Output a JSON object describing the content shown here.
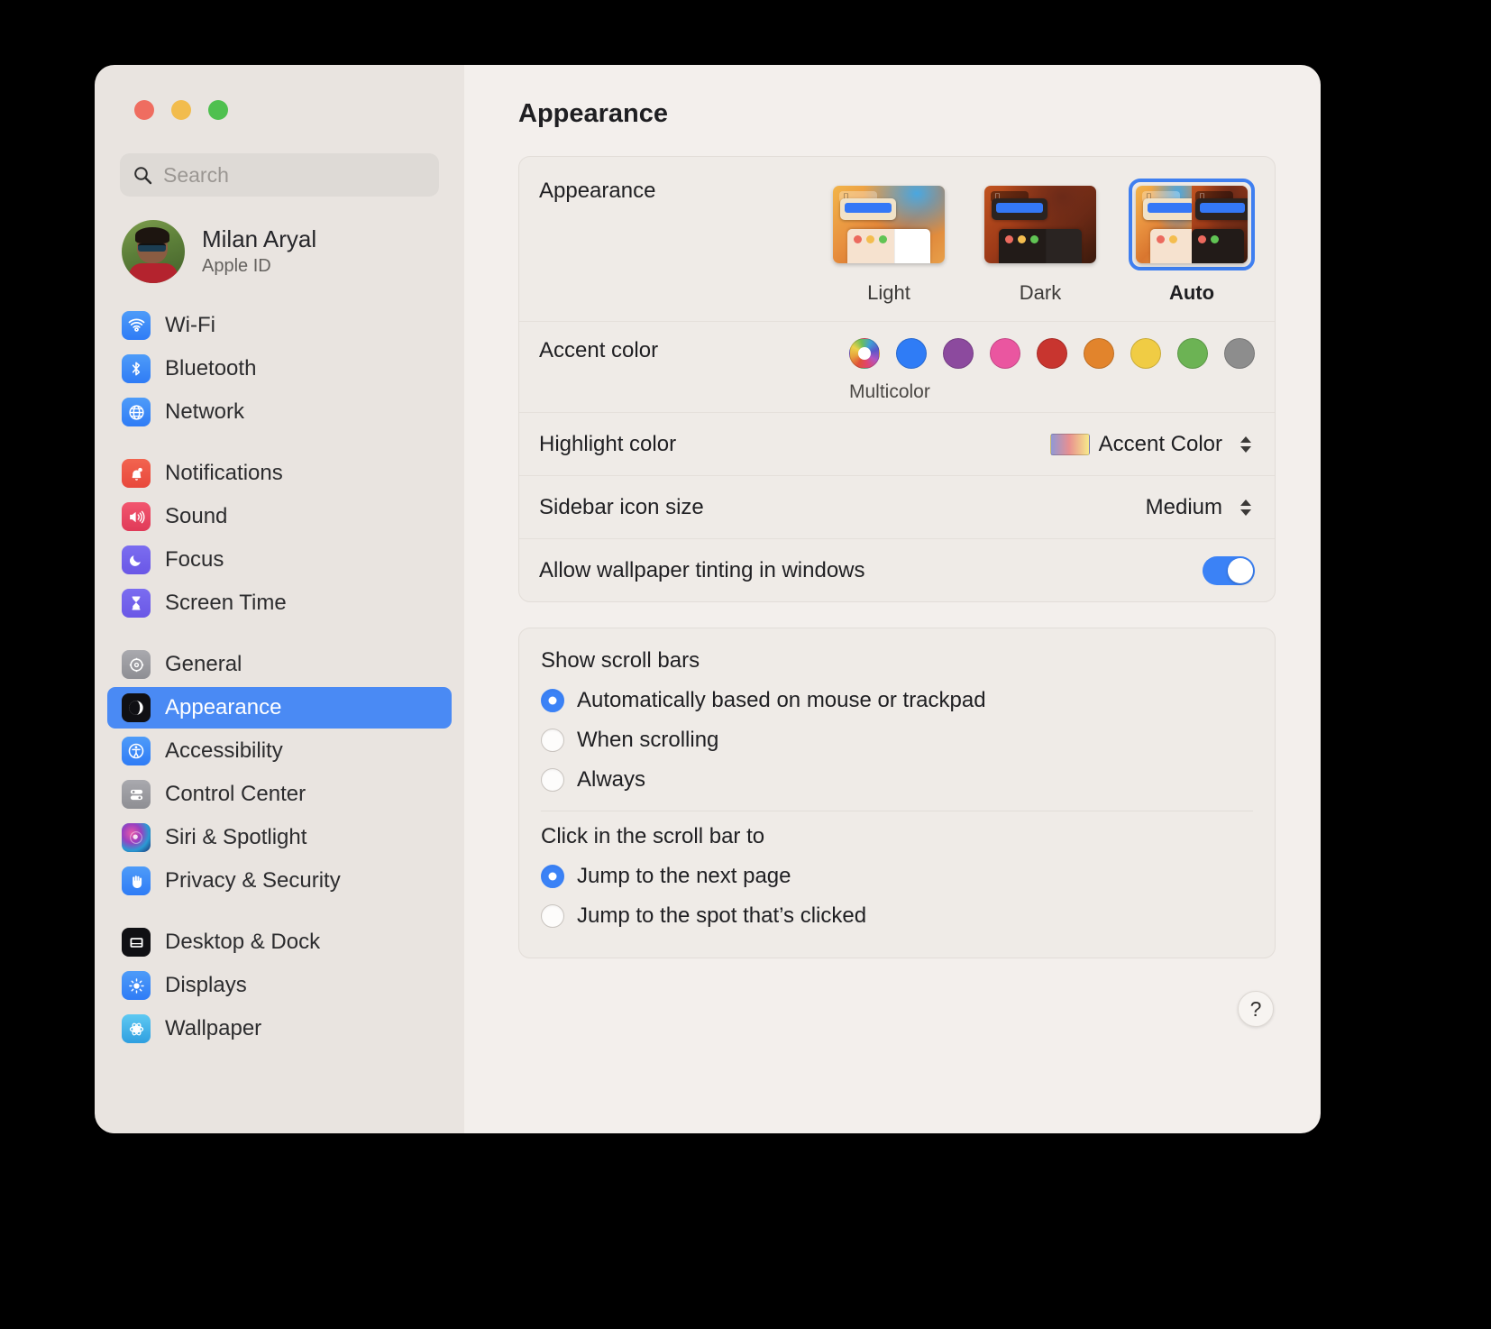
{
  "window": {
    "controls": [
      "close",
      "minimize",
      "zoom"
    ]
  },
  "sidebar": {
    "search": {
      "placeholder": "Search",
      "value": ""
    },
    "profile": {
      "name": "Milan Aryal",
      "subtitle": "Apple ID"
    },
    "groups": [
      {
        "items": [
          {
            "label": "Wi-Fi",
            "icon": "wifi-icon"
          },
          {
            "label": "Bluetooth",
            "icon": "bluetooth-icon"
          },
          {
            "label": "Network",
            "icon": "network-icon"
          }
        ]
      },
      {
        "items": [
          {
            "label": "Notifications",
            "icon": "notifications-icon"
          },
          {
            "label": "Sound",
            "icon": "sound-icon"
          },
          {
            "label": "Focus",
            "icon": "focus-icon"
          },
          {
            "label": "Screen Time",
            "icon": "screen-time-icon"
          }
        ]
      },
      {
        "items": [
          {
            "label": "General",
            "icon": "general-icon"
          },
          {
            "label": "Appearance",
            "icon": "appearance-icon",
            "selected": true
          },
          {
            "label": "Accessibility",
            "icon": "accessibility-icon"
          },
          {
            "label": "Control Center",
            "icon": "control-center-icon"
          },
          {
            "label": "Siri & Spotlight",
            "icon": "siri-icon"
          },
          {
            "label": "Privacy & Security",
            "icon": "privacy-icon"
          }
        ]
      },
      {
        "items": [
          {
            "label": "Desktop & Dock",
            "icon": "desktop-dock-icon"
          },
          {
            "label": "Displays",
            "icon": "displays-icon"
          },
          {
            "label": "Wallpaper",
            "icon": "wallpaper-icon"
          }
        ]
      }
    ]
  },
  "main": {
    "title": "Appearance",
    "appearance": {
      "label": "Appearance",
      "options": [
        {
          "name": "Light",
          "selected": false
        },
        {
          "name": "Dark",
          "selected": false
        },
        {
          "name": "Auto",
          "selected": true
        }
      ]
    },
    "accent": {
      "label": "Accent color",
      "caption": "Multicolor",
      "selected_index": 0,
      "swatches": [
        {
          "name": "Multicolor",
          "color": "multicolor"
        },
        {
          "name": "Blue",
          "color": "#2f7cf6"
        },
        {
          "name": "Purple",
          "color": "#8c4a9e"
        },
        {
          "name": "Pink",
          "color": "#ea56a0"
        },
        {
          "name": "Red",
          "color": "#c8352f"
        },
        {
          "name": "Orange",
          "color": "#e2842c"
        },
        {
          "name": "Yellow",
          "color": "#f0cc44"
        },
        {
          "name": "Green",
          "color": "#6cb354"
        },
        {
          "name": "Graphite",
          "color": "#8d8d8d"
        }
      ]
    },
    "highlight": {
      "label": "Highlight color",
      "value": "Accent Color"
    },
    "sidebar_icon_size": {
      "label": "Sidebar icon size",
      "value": "Medium"
    },
    "wallpaper_tinting": {
      "label": "Allow wallpaper tinting in windows",
      "enabled": true
    },
    "scroll_bars": {
      "title": "Show scroll bars",
      "options": [
        {
          "label": "Automatically based on mouse or trackpad",
          "selected": true
        },
        {
          "label": "When scrolling",
          "selected": false
        },
        {
          "label": "Always",
          "selected": false
        }
      ]
    },
    "scroll_click": {
      "title": "Click in the scroll bar to",
      "options": [
        {
          "label": "Jump to the next page",
          "selected": true
        },
        {
          "label": "Jump to the spot that’s clicked",
          "selected": false
        }
      ]
    },
    "help_label": "?"
  }
}
